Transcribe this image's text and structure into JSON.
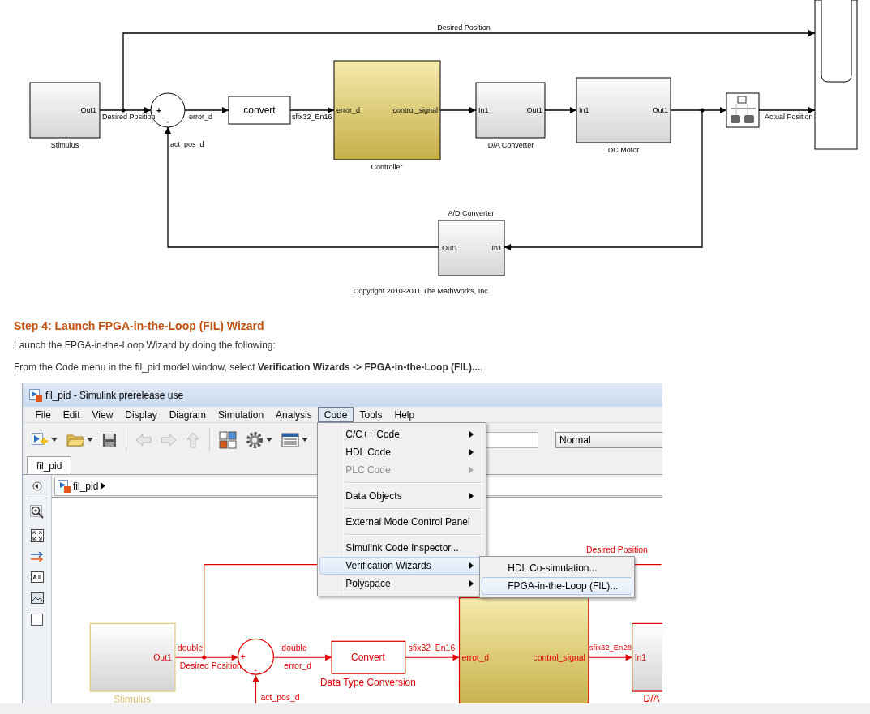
{
  "diagram": {
    "stimulus": {
      "name": "Stimulus",
      "out": "Out1"
    },
    "sum_signs": [
      "+",
      "-"
    ],
    "convert": {
      "label": "convert"
    },
    "controller": {
      "name": "Controller",
      "in": "error_d",
      "out": "control_signal"
    },
    "da": {
      "name": "D/A Converter",
      "in": "In1",
      "out": "Out1"
    },
    "motor": {
      "name": "DC Motor",
      "in": "In1",
      "out": "Out1"
    },
    "ad": {
      "name": "A/D Converter",
      "in": "In1",
      "out": "Out1"
    },
    "signals": {
      "reference": "Desired Position",
      "desired": "Desired Position",
      "error": "error_d",
      "converted": "sfix32_En16",
      "actual": "Actual Position",
      "feedback": "act_pos_d"
    },
    "copyright": "Copyright 2010-2011 The MathWorks, Inc."
  },
  "step": {
    "heading": "Step 4: Launch FPGA-in-the-Loop (FIL) Wizard",
    "intro": "Launch the FPGA-in-the-Loop Wizard by doing the following:",
    "instruction": "From the Code menu in the fil_pid model window, select **Verification Wizards -> FPGA-in-the-Loop (FIL)...**."
  },
  "window": {
    "title": "fil_pid - Simulink prerelease use",
    "menus": [
      {
        "label": "File",
        "selected": false
      },
      {
        "label": "Edit",
        "selected": false
      },
      {
        "label": "View",
        "selected": false
      },
      {
        "label": "Display",
        "selected": false
      },
      {
        "label": "Diagram",
        "selected": false
      },
      {
        "label": "Simulation",
        "selected": false
      },
      {
        "label": "Analysis",
        "selected": false
      },
      {
        "label": "Code",
        "selected": true
      },
      {
        "label": "Tools",
        "selected": false
      },
      {
        "label": "Help",
        "selected": false
      }
    ],
    "simulation_mode": "Normal",
    "tab": "fil_pid",
    "breadcrumb": "fil_pid",
    "code_menu": [
      [
        {
          "label": "C/C++ Code",
          "submenu": true,
          "disabled": false,
          "selected": false
        },
        {
          "label": "HDL Code",
          "submenu": true,
          "disabled": false,
          "selected": false
        },
        {
          "label": "PLC Code",
          "submenu": true,
          "disabled": true,
          "selected": false
        }
      ],
      [
        {
          "label": "Data Objects",
          "submenu": true,
          "disabled": false,
          "selected": false
        }
      ],
      [
        {
          "label": "External Mode Control Panel",
          "submenu": false,
          "disabled": false,
          "selected": false
        }
      ],
      [
        {
          "label": "Simulink Code Inspector...",
          "submenu": false,
          "disabled": false,
          "selected": false
        },
        {
          "label": "Verification Wizards",
          "submenu": true,
          "disabled": false,
          "selected": true,
          "items": [
            {
              "label": "HDL Co-simulation...",
              "selected": false
            },
            {
              "label": "FPGA-in-the-Loop (FIL)...",
              "selected": true
            }
          ]
        },
        {
          "label": "Polyspace",
          "submenu": true,
          "disabled": false,
          "selected": false
        }
      ]
    ]
  },
  "model": {
    "stimulus": {
      "name": "Stimulus",
      "out": "Out1"
    },
    "sum_signs": [
      "+",
      "-"
    ],
    "convert": {
      "label": "Convert",
      "name": "Data Type Conversion"
    },
    "controller": {
      "in": "error_d",
      "out": "control_signal"
    },
    "da": {
      "in": "In1",
      "name": "D/A"
    },
    "signals": {
      "reference": "Desired Position",
      "input_type": "double",
      "desired": "Desired Position",
      "error_type": "double",
      "error": "error_d",
      "converted": "sfix32_En16",
      "control_type": "sfix32_En28",
      "feedback": "act_pos_d"
    }
  }
}
